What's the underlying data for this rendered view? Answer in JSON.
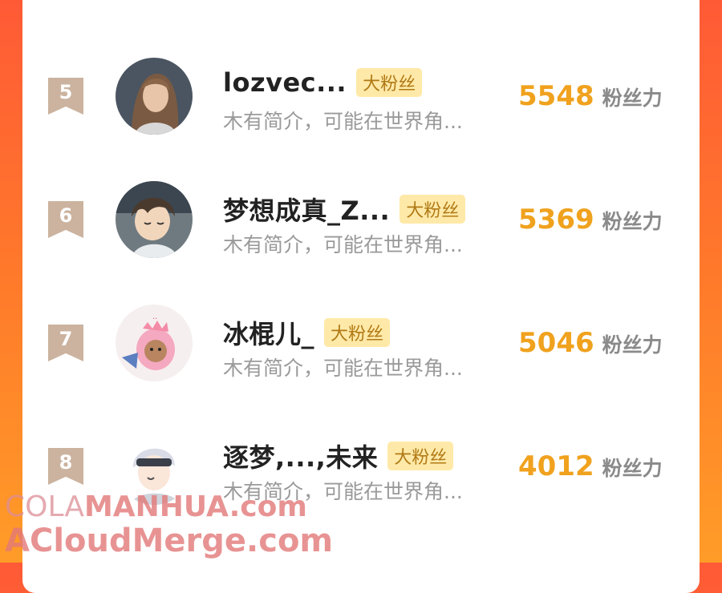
{
  "list": {
    "items": [
      {
        "rank": "5",
        "name": "lozvec...",
        "badge": "大粉丝",
        "bio": "木有简介，可能在世界角...",
        "score": "5548",
        "score_label": "粉丝力",
        "avatar": "portrait-woman"
      },
      {
        "rank": "6",
        "name": "梦想成真_Z...",
        "badge": "大粉丝",
        "bio": "木有简介，可能在世界角...",
        "score": "5369",
        "score_label": "粉丝力",
        "avatar": "anime-boy"
      },
      {
        "rank": "7",
        "name": "冰棍儿_",
        "badge": "大粉丝",
        "bio": "木有简介，可能在世界角...",
        "score": "5046",
        "score_label": "粉丝力",
        "avatar": "pink-dino"
      },
      {
        "rank": "8",
        "name": "逐梦,...,未来",
        "badge": "大粉丝",
        "bio": "木有简介，可能在世界角...",
        "score": "4012",
        "score_label": "粉丝力",
        "avatar": "anime-sleep-mask"
      }
    ]
  },
  "watermark": {
    "line1_a": "COLA",
    "line1_b": "MANHUA.com",
    "line2": "ACloudMerge.com"
  },
  "colors": {
    "score": "#f0a21e",
    "badge_bg": "#ffe9a8",
    "rank_bg": "#cbb39f",
    "bg_gradient_top": "#ff5a36",
    "bg_gradient_bottom": "#ff9c28"
  }
}
